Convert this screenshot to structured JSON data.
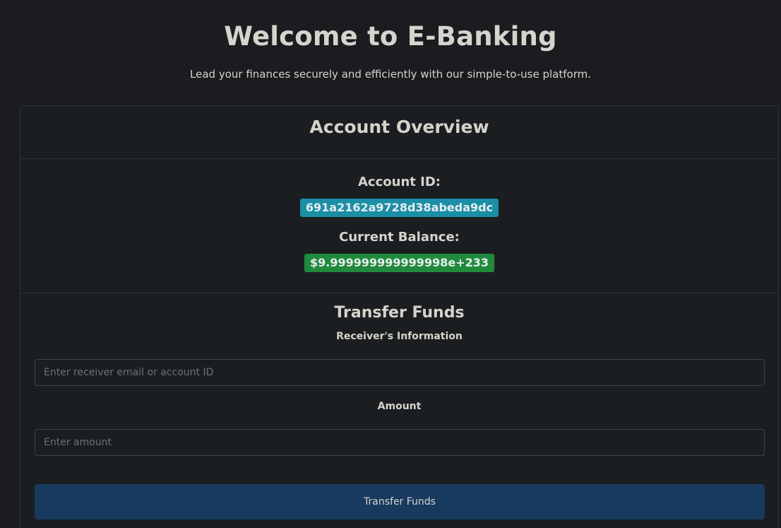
{
  "hero": {
    "title": "Welcome to E-Banking",
    "subtitle": "Lead your finances securely and efficiently with our simple-to-use platform."
  },
  "overview": {
    "title": "Account Overview",
    "account_id_label": "Account ID:",
    "account_id_value": "691a2162a9728d38abeda9dc",
    "balance_label": "Current Balance:",
    "balance_value": "$9.999999999999998e+233"
  },
  "transfer": {
    "title": "Transfer Funds",
    "receiver_label": "Receiver's Information",
    "receiver_placeholder": "Enter receiver email or account ID",
    "receiver_value": "",
    "amount_label": "Amount",
    "amount_placeholder": "Enter amount",
    "amount_value": "",
    "submit_label": "Transfer Funds"
  },
  "colors": {
    "background": "#1a1c1f",
    "account_badge": "#1a8fa6",
    "balance_badge": "#208a3c",
    "primary_button": "#173a5e"
  }
}
